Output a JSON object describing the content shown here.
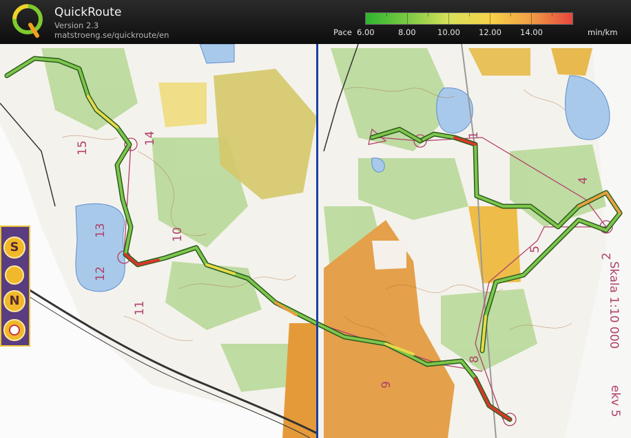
{
  "app": {
    "name": "QuickRoute",
    "version": "Version 2.3",
    "url": "matstroeng.se/quickroute/en"
  },
  "pace_scale": {
    "label": "Pace",
    "ticks": [
      "6.00",
      "8.00",
      "10.00",
      "12.00",
      "14.00"
    ],
    "unit": "min/km"
  },
  "map": {
    "control_numbers_left": [
      "15",
      "14",
      "13",
      "12",
      "10",
      "11"
    ],
    "control_numbers_right": [
      "1",
      "4",
      "5",
      "2",
      "8",
      "9",
      "7"
    ],
    "legend_letters": [
      "S",
      "N"
    ],
    "right_margin_text": [
      "Skala 1:10 000",
      "ekv 5"
    ]
  },
  "colors": {
    "route_green": "#3c9e2c",
    "route_yellow": "#e8d94a",
    "route_red": "#d9362c",
    "course_line": "#b0406a",
    "divider": "#1a3fa8"
  }
}
